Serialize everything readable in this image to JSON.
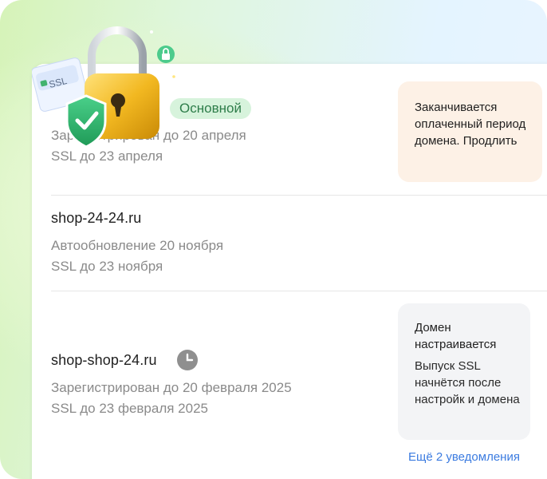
{
  "domains": [
    {
      "name": "",
      "badge": "Основной",
      "line1": "Зарегистрирован до 20 апреля",
      "line2": "SSL до 23 апреля"
    },
    {
      "name": "shop-24-24.ru",
      "line1": "Автообновление 20 ноября",
      "line2": "SSL до 23 ноября"
    },
    {
      "name": "shop-shop-24.ru",
      "line1": "Зарегистрирован до 20 февраля 2025",
      "line2": "SSL до 23 февраля 2025"
    }
  ],
  "notices": {
    "expiring": "Заканчивается оплаченный период домена. Продлить",
    "setup_title": "Домен настраивается",
    "setup_body": "Выпуск SSL начнётся после настройк и домена"
  },
  "more_link": "Ещё 2 уведомления",
  "illustration": {
    "ssl_label": "SSL",
    "icons": [
      "padlock-icon",
      "shield-check-icon",
      "ssl-certificate-icon",
      "small-lock-icon"
    ]
  },
  "colors": {
    "badge_bg": "#d7f3dc",
    "badge_text": "#2e7d4a",
    "notice_orange_bg": "#fdf1e6",
    "notice_gray_bg": "#f3f4f6",
    "link": "#3b7be0"
  }
}
